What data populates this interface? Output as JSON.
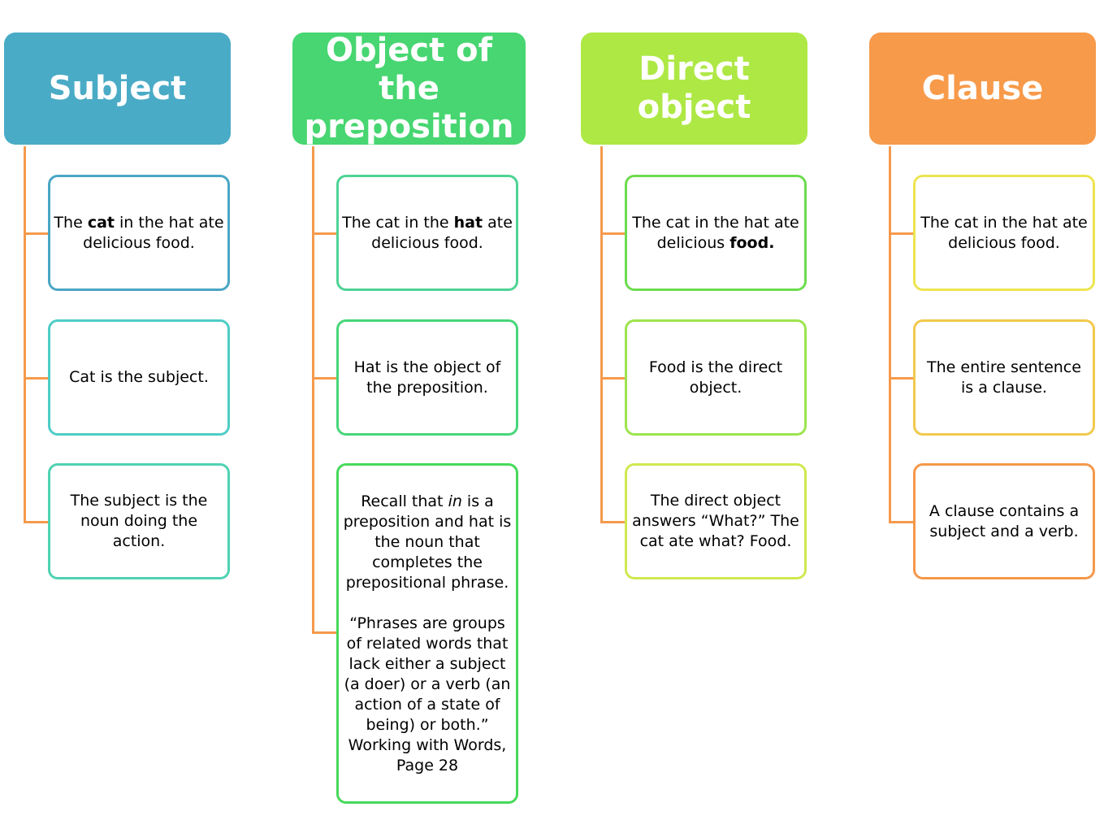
{
  "line_color": "#f59a4c",
  "columns": [
    {
      "title": "Subject",
      "color": "#4aabc6",
      "items": [
        {
          "border": "#4aa6c4",
          "text": [
            {
              "t": "The "
            },
            {
              "t": "cat",
              "b": true
            },
            {
              "t": " in the hat ate delicious food."
            }
          ]
        },
        {
          "border": "#4ecdc6",
          "text": [
            {
              "t": "Cat is the subject."
            }
          ]
        },
        {
          "border": "#4fd2b2",
          "text": [
            {
              "t": "The subject is the noun doing the action."
            }
          ]
        }
      ]
    },
    {
      "title": "Object of the preposition",
      "color": "#47d671",
      "items": [
        {
          "border": "#4ed494",
          "text": [
            {
              "t": "The cat in the "
            },
            {
              "t": "hat",
              "b": true
            },
            {
              "t": " ate delicious food."
            }
          ]
        },
        {
          "border": "#47d67a",
          "text": [
            {
              "t": "Hat is the object of the preposition."
            }
          ]
        },
        {
          "border": "#46d95a",
          "text": [
            {
              "t": "Recall that "
            },
            {
              "t": "in",
              "i": true
            },
            {
              "t": " is a preposition and hat is the noun that completes the prepositional phrase."
            },
            {
              "br": true
            },
            {
              "br": true
            },
            {
              "t": "“Phrases are groups of related words that lack either a subject (a doer) or a verb (an action of a state of being) or both.” Working with Words, Page 28"
            }
          ]
        }
      ]
    },
    {
      "title": "Direct object",
      "color": "#aee845",
      "items": [
        {
          "border": "#6cdc4e",
          "text": [
            {
              "t": "The cat in the hat ate delicious "
            },
            {
              "t": "food.",
              "b": true
            }
          ]
        },
        {
          "border": "#9ce44e",
          "text": [
            {
              "t": "Food is the direct object."
            }
          ]
        },
        {
          "border": "#d0e84f",
          "text": [
            {
              "t": "The direct object answers “What?” The cat ate what? Food."
            }
          ]
        }
      ]
    },
    {
      "title": "Clause",
      "color": "#f79a4a",
      "items": [
        {
          "border": "#ece54f",
          "text": [
            {
              "t": "The cat in the hat ate delicious food."
            }
          ]
        },
        {
          "border": "#f2c94d",
          "text": [
            {
              "t": "The entire sentence is a clause."
            }
          ]
        },
        {
          "border": "#f5984a",
          "text": [
            {
              "t": "A clause contains a subject and a verb."
            }
          ]
        }
      ]
    }
  ]
}
